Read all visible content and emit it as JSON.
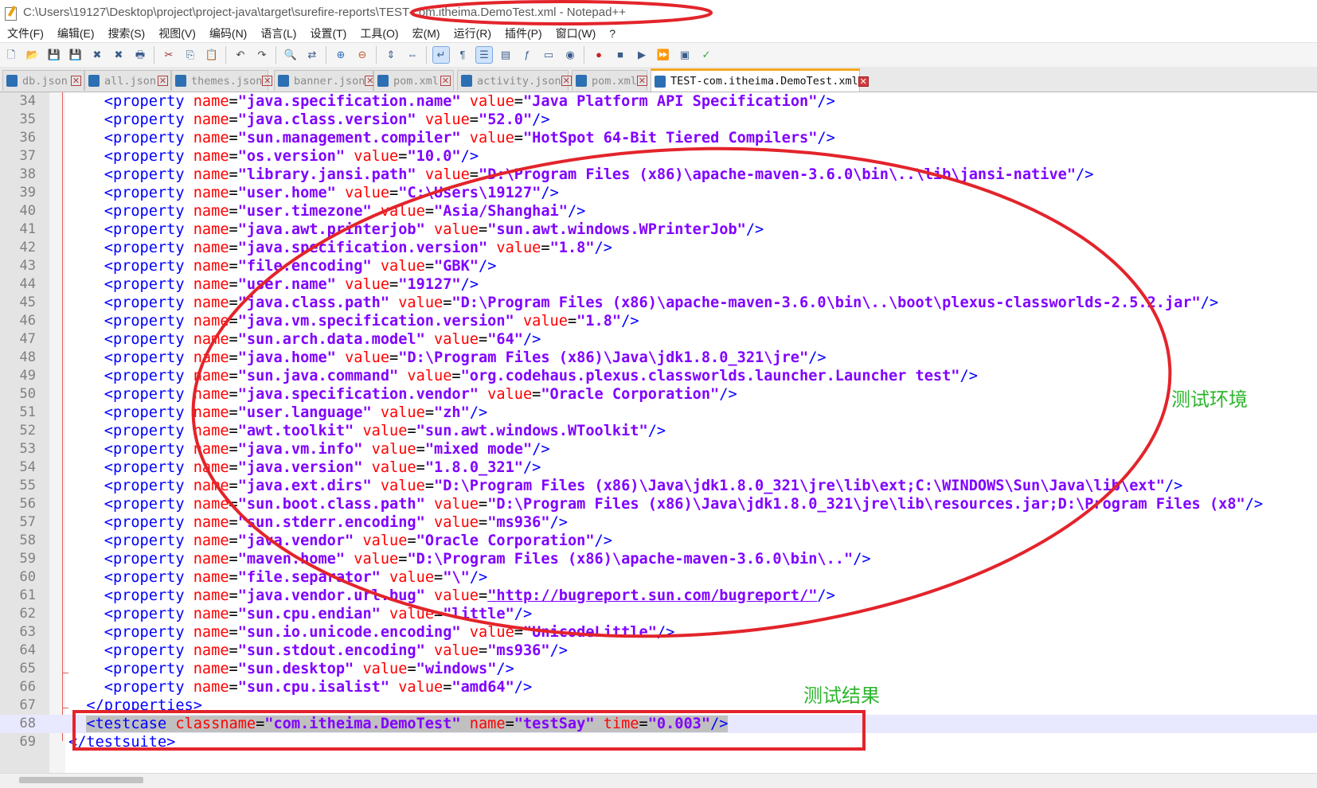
{
  "window": {
    "title_path": "C:\\Users\\19127\\Desktop\\project\\project-java\\target\\surefire-reports\\TEST-com.itheima.DemoTest.xml - Notepad++"
  },
  "menu": [
    "文件(F)",
    "编辑(E)",
    "搜索(S)",
    "视图(V)",
    "编码(N)",
    "语言(L)",
    "设置(T)",
    "工具(O)",
    "宏(M)",
    "运行(R)",
    "插件(P)",
    "窗口(W)",
    "?"
  ],
  "toolbar_icons": [
    "new-file-icon",
    "open-file-icon",
    "save-icon",
    "save-all-icon",
    "close-icon",
    "close-all-icon",
    "print-icon",
    "cut-icon",
    "copy-icon",
    "paste-icon",
    "undo-icon",
    "redo-icon",
    "find-icon",
    "replace-icon",
    "zoom-in-icon",
    "zoom-out-icon",
    "sync-vertical-icon",
    "sync-horizontal-icon",
    "word-wrap-icon",
    "show-all-chars-icon",
    "indent-guide-icon",
    "doc-map-icon",
    "function-list-icon",
    "folder-workspace-icon",
    "monitor-icon",
    "macro-record-icon",
    "macro-stop-icon",
    "macro-play-icon",
    "macro-run-multiple-icon",
    "macro-save-icon",
    "spell-check-icon"
  ],
  "tabs": [
    {
      "label": "db.json",
      "active": false
    },
    {
      "label": "all.json",
      "active": false
    },
    {
      "label": "themes.json",
      "active": false
    },
    {
      "label": "banner.json",
      "active": false
    },
    {
      "label": "pom.xml",
      "active": false
    },
    {
      "label": "activity.json",
      "active": false
    },
    {
      "label": "pom.xml",
      "active": false
    },
    {
      "label": "TEST-com.itheima.DemoTest.xml",
      "active": true
    }
  ],
  "properties": [
    {
      "line": "34",
      "name": "java.specification.name",
      "value": "Java Platform API Specification"
    },
    {
      "line": "35",
      "name": "java.class.version",
      "value": "52.0"
    },
    {
      "line": "36",
      "name": "sun.management.compiler",
      "value": "HotSpot 64-Bit Tiered Compilers"
    },
    {
      "line": "37",
      "name": "os.version",
      "value": "10.0"
    },
    {
      "line": "38",
      "name": "library.jansi.path",
      "value": "D:\\Program Files (x86)\\apache-maven-3.6.0\\bin\\..\\lib\\jansi-native"
    },
    {
      "line": "39",
      "name": "user.home",
      "value": "C:\\Users\\19127"
    },
    {
      "line": "40",
      "name": "user.timezone",
      "value": "Asia/Shanghai"
    },
    {
      "line": "41",
      "name": "java.awt.printerjob",
      "value": "sun.awt.windows.WPrinterJob"
    },
    {
      "line": "42",
      "name": "java.specification.version",
      "value": "1.8"
    },
    {
      "line": "43",
      "name": "file.encoding",
      "value": "GBK"
    },
    {
      "line": "44",
      "name": "user.name",
      "value": "19127"
    },
    {
      "line": "45",
      "name": "java.class.path",
      "value": "D:\\Program Files (x86)\\apache-maven-3.6.0\\bin\\..\\boot\\plexus-classworlds-2.5.2.jar"
    },
    {
      "line": "46",
      "name": "java.vm.specification.version",
      "value": "1.8"
    },
    {
      "line": "47",
      "name": "sun.arch.data.model",
      "value": "64"
    },
    {
      "line": "48",
      "name": "java.home",
      "value": "D:\\Program Files (x86)\\Java\\jdk1.8.0_321\\jre"
    },
    {
      "line": "49",
      "name": "sun.java.command",
      "value": "org.codehaus.plexus.classworlds.launcher.Launcher test"
    },
    {
      "line": "50",
      "name": "java.specification.vendor",
      "value": "Oracle Corporation"
    },
    {
      "line": "51",
      "name": "user.language",
      "value": "zh"
    },
    {
      "line": "52",
      "name": "awt.toolkit",
      "value": "sun.awt.windows.WToolkit"
    },
    {
      "line": "53",
      "name": "java.vm.info",
      "value": "mixed mode"
    },
    {
      "line": "54",
      "name": "java.version",
      "value": "1.8.0_321"
    },
    {
      "line": "55",
      "name": "java.ext.dirs",
      "value": "D:\\Program Files (x86)\\Java\\jdk1.8.0_321\\jre\\lib\\ext;C:\\WINDOWS\\Sun\\Java\\lib\\ext"
    },
    {
      "line": "56",
      "name": "sun.boot.class.path",
      "value": "D:\\Program Files (x86)\\Java\\jdk1.8.0_321\\jre\\lib\\resources.jar;D:\\Program Files (x8"
    },
    {
      "line": "57",
      "name": "sun.stderr.encoding",
      "value": "ms936"
    },
    {
      "line": "58",
      "name": "java.vendor",
      "value": "Oracle Corporation"
    },
    {
      "line": "59",
      "name": "maven.home",
      "value": "D:\\Program Files (x86)\\apache-maven-3.6.0\\bin\\.."
    },
    {
      "line": "60",
      "name": "file.separator",
      "value": "\\"
    },
    {
      "line": "61",
      "name": "java.vendor.url.bug",
      "value": "http://bugreport.sun.com/bugreport/",
      "link": true
    },
    {
      "line": "62",
      "name": "sun.cpu.endian",
      "value": "little"
    },
    {
      "line": "63",
      "name": "sun.io.unicode.encoding",
      "value": "UnicodeLittle"
    },
    {
      "line": "64",
      "name": "sun.stdout.encoding",
      "value": "ms936"
    },
    {
      "line": "65",
      "name": "sun.desktop",
      "value": "windows"
    },
    {
      "line": "66",
      "name": "sun.cpu.isalist",
      "value": "amd64"
    }
  ],
  "closing": {
    "properties_line": "67",
    "properties_text": "</properties>",
    "testcase_line": "68",
    "testcase": {
      "classname": "com.itheima.DemoTest",
      "name": "testSay",
      "time": "0.003"
    },
    "testsuite_line": "69",
    "testsuite_text": "</testsuite>"
  },
  "annotations": {
    "env_label": "测试环境",
    "result_label": "测试结果",
    "color": "#e3242b",
    "label_color": "#2cb52c"
  }
}
